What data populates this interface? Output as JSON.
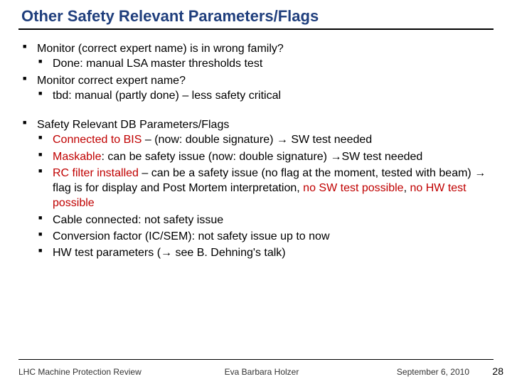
{
  "title": "Other Safety Relevant Parameters/Flags",
  "block1": [
    {
      "text": "Monitor (correct expert name) is in wrong family?",
      "sub": [
        {
          "plain": "Done: manual LSA master thresholds test"
        }
      ]
    },
    {
      "text": "Monitor correct expert name?",
      "sub": [
        {
          "plain": "tbd: manual (partly done) – less safety critical"
        }
      ]
    }
  ],
  "block2": {
    "heading": "Safety Relevant DB Parameters/Flags",
    "items": {
      "bis": {
        "red1": "Connected to BIS",
        "mid": " – (now: double signature) ",
        "arrow": "→",
        "tail": " SW test needed"
      },
      "maskable": {
        "red1": "Maskable",
        "mid": ": can be safety issue (now: double signature) ",
        "arrow": "→",
        "tail": "SW test needed"
      },
      "rcfilter": {
        "red1": "RC filter installed",
        "mid1": " – can be a safety issue (no flag at the moment, tested with beam) ",
        "arrow": "→",
        "mid2": " flag is for display and Post Mortem interpretation, ",
        "red2": "no SW test possible",
        "sep": ", ",
        "red3": "no HW test possible"
      },
      "cable": {
        "plain": "Cable connected: not safety issue"
      },
      "conv": {
        "plain": "Conversion factor (IC/SEM): not safety issue up to now"
      },
      "hw": {
        "pre": "HW test parameters (",
        "arrow": "→",
        "post": " see B. Dehning's talk)"
      }
    }
  },
  "footer": {
    "left": "LHC Machine Protection Review",
    "center": "Eva Barbara Holzer",
    "right": "September 6, 2010",
    "page": "28"
  }
}
